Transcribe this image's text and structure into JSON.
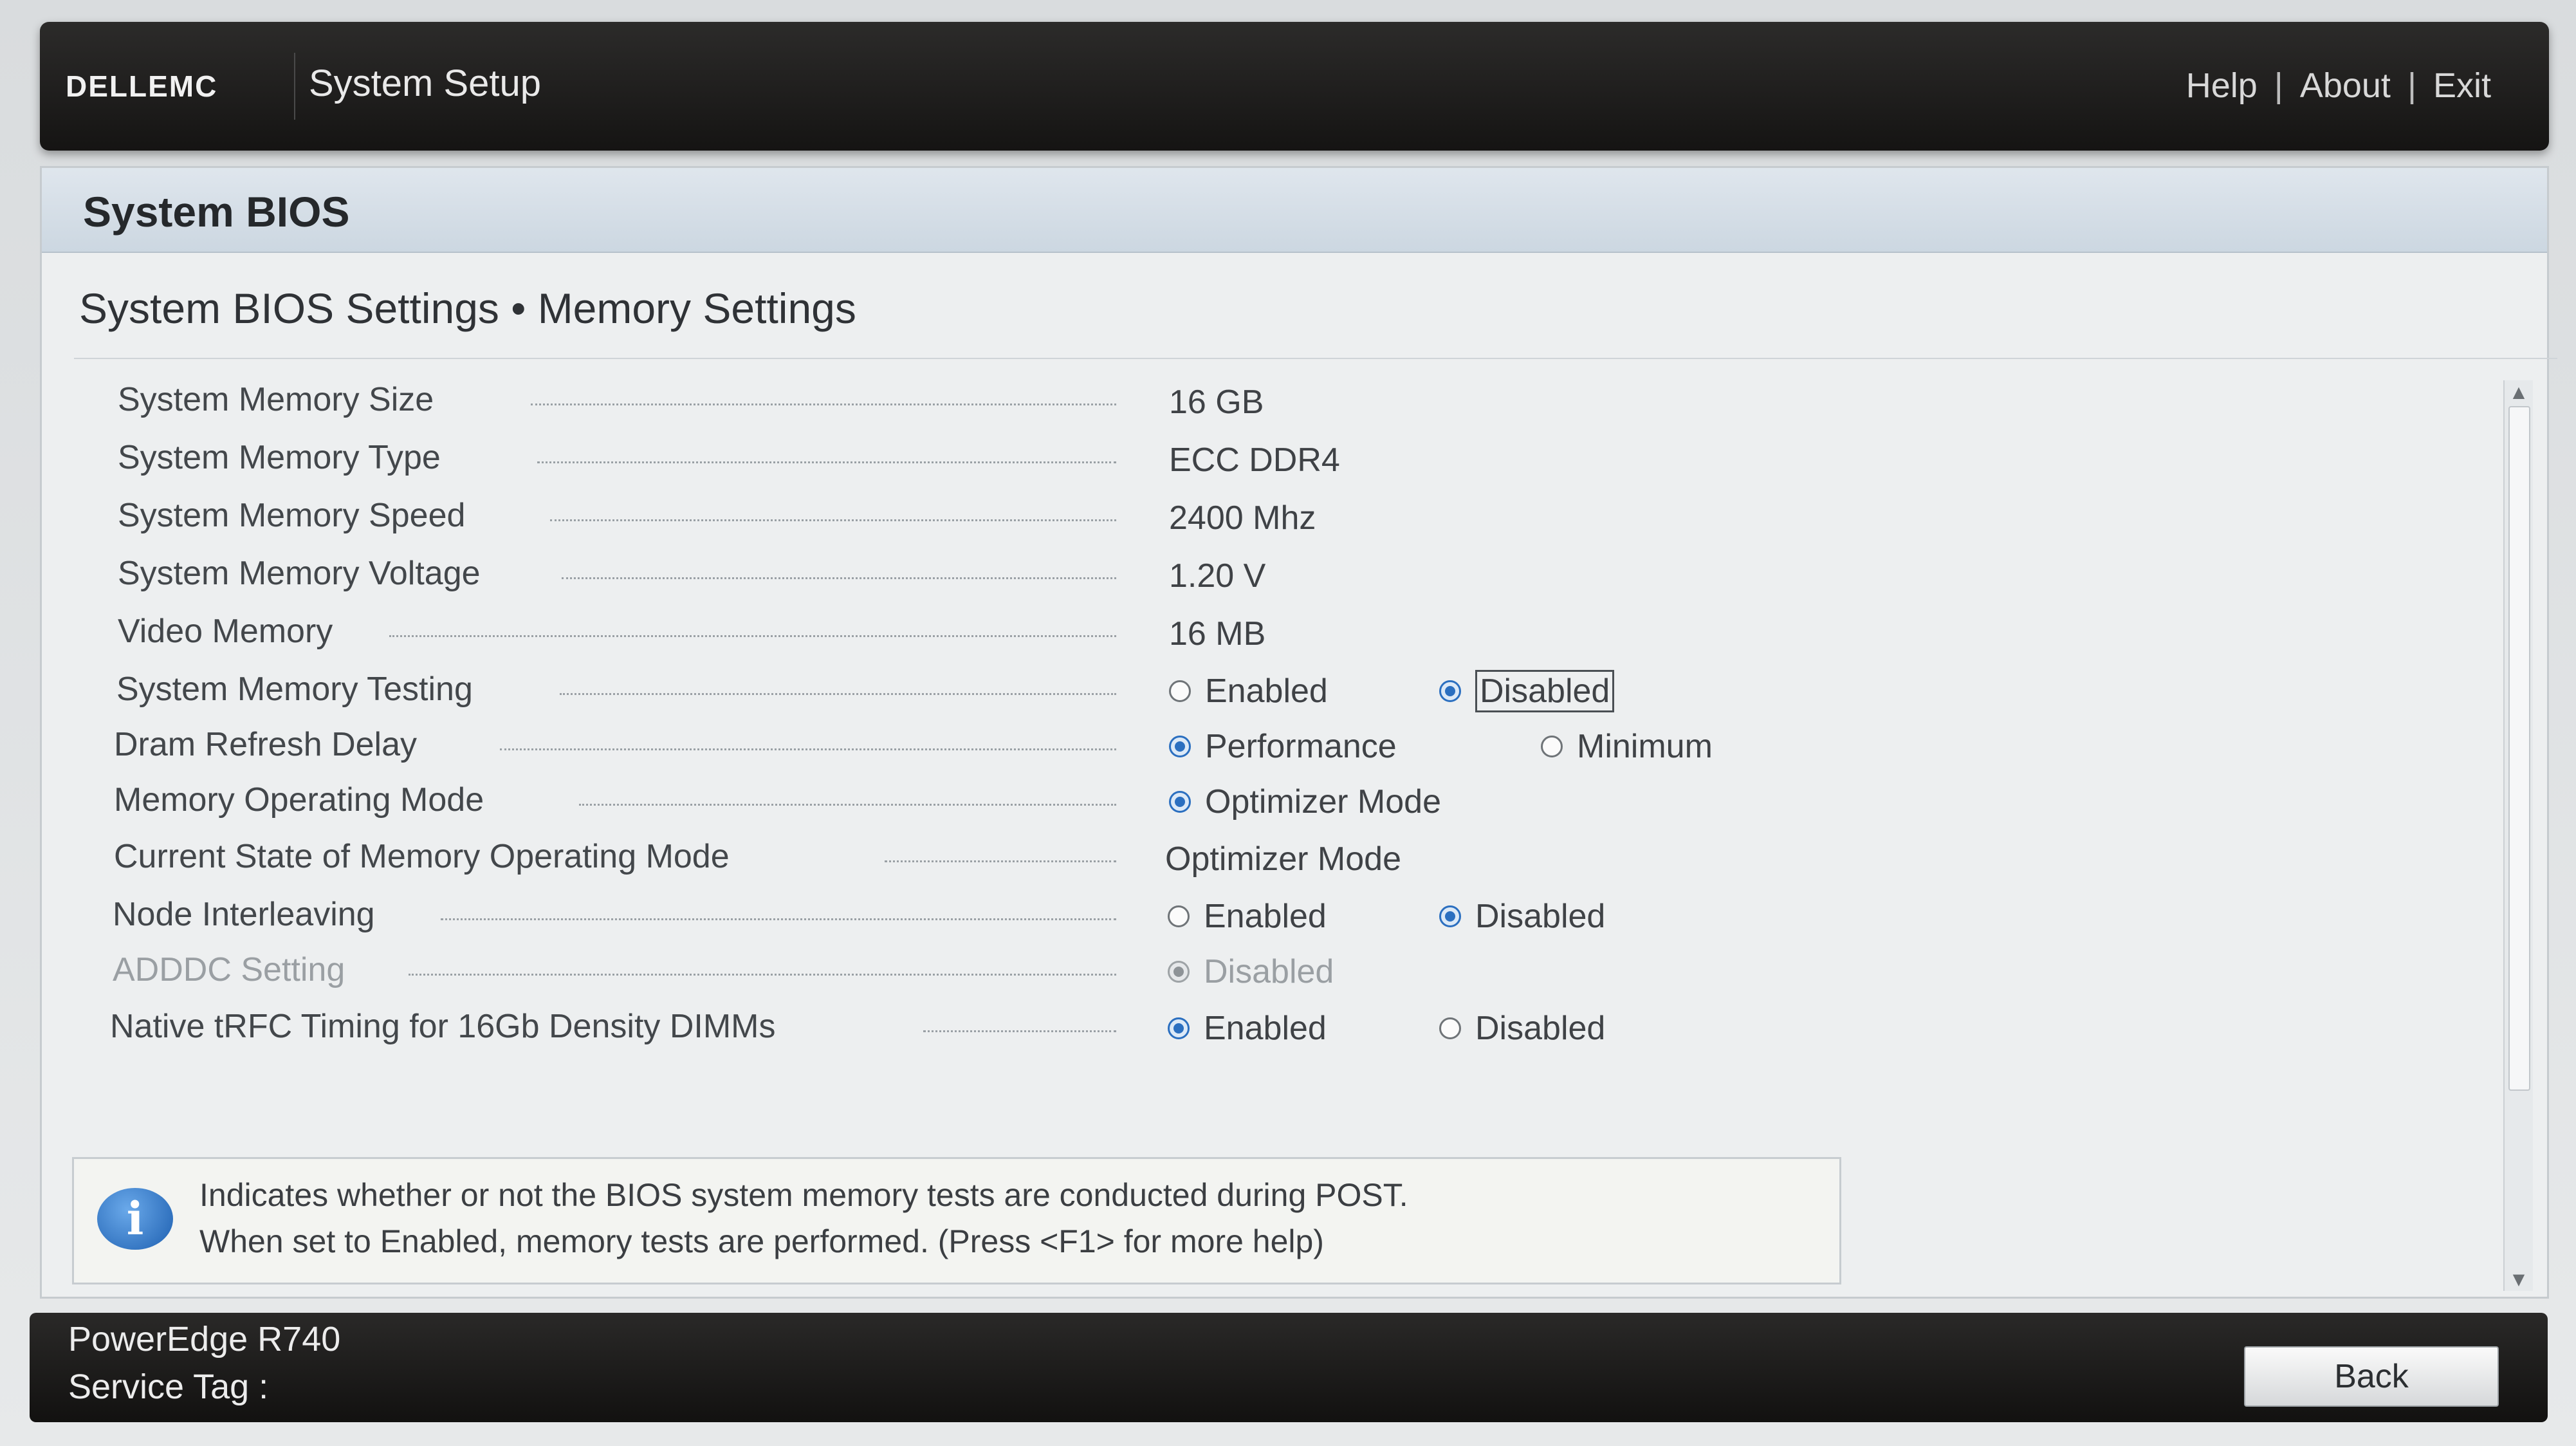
{
  "header": {
    "logo_text": "DELLEMC",
    "app_title": "System Setup",
    "links": [
      "Help",
      "About",
      "Exit"
    ],
    "separator": "|"
  },
  "panel": {
    "title": "System BIOS",
    "breadcrumb": "System BIOS Settings • Memory Settings"
  },
  "settings": {
    "memory_size": {
      "label": "System Memory Size",
      "value": "16 GB"
    },
    "memory_type": {
      "label": "System Memory Type",
      "value": "ECC DDR4"
    },
    "memory_speed": {
      "label": "System Memory Speed",
      "value": "2400 Mhz"
    },
    "memory_voltage": {
      "label": "System Memory Voltage",
      "value": "1.20 V"
    },
    "video_memory": {
      "label": "Video Memory",
      "value": "16 MB"
    },
    "memory_testing": {
      "label": "System Memory Testing",
      "options": [
        "Enabled",
        "Disabled"
      ],
      "selected": "Disabled"
    },
    "dram_refresh": {
      "label": "Dram Refresh Delay",
      "options": [
        "Performance",
        "Minimum"
      ],
      "selected": "Performance"
    },
    "operating_mode": {
      "label": "Memory Operating Mode",
      "options": [
        "Optimizer Mode"
      ],
      "selected": "Optimizer Mode"
    },
    "current_state": {
      "label": "Current State of Memory Operating Mode",
      "value": "Optimizer Mode"
    },
    "node_interleaving": {
      "label": "Node Interleaving",
      "options": [
        "Enabled",
        "Disabled"
      ],
      "selected": "Disabled"
    },
    "adddc": {
      "label": "ADDDC Setting",
      "options": [
        "Disabled"
      ],
      "selected": "Disabled"
    },
    "native_trfc": {
      "label": "Native tRFC Timing for 16Gb Density DIMMs",
      "options": [
        "Enabled",
        "Disabled"
      ],
      "selected": "Enabled"
    }
  },
  "help": {
    "line1": "Indicates whether or not the BIOS system memory tests are conducted during POST.",
    "line2": "When set to Enabled, memory tests are performed. (Press <F1> for more help)"
  },
  "footer": {
    "model": "PowerEdge R740",
    "service_tag_label": "Service Tag :",
    "back_label": "Back"
  },
  "icons": {
    "info": "info-icon",
    "scroll_up": "scroll-up-icon",
    "scroll_down": "scroll-down-icon"
  }
}
